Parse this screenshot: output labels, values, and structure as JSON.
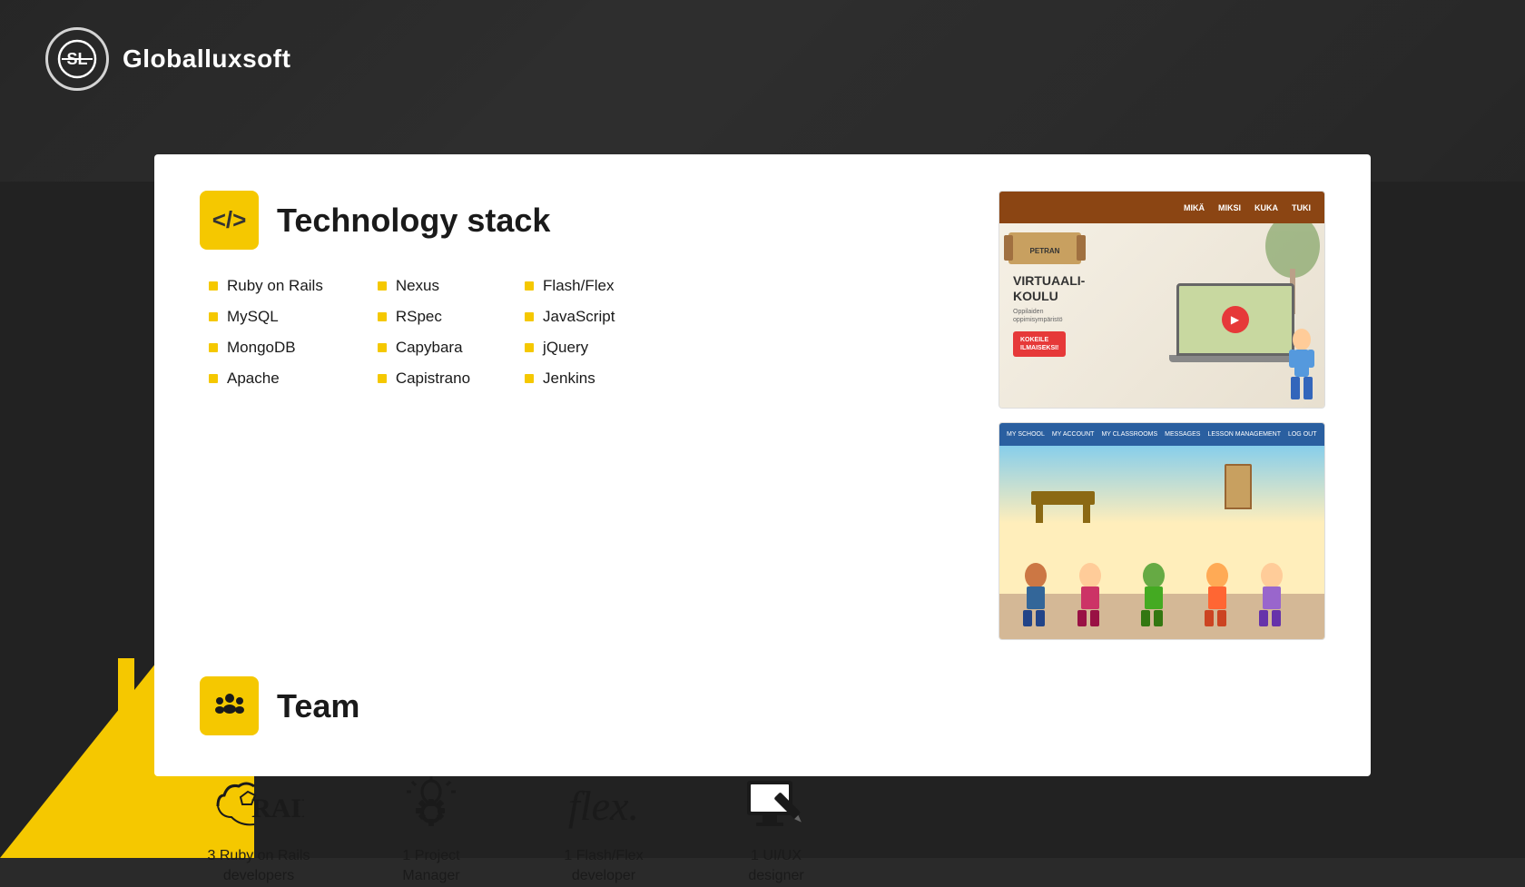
{
  "company": {
    "name": "Globalluxsoft",
    "logo_alt": "GL logo"
  },
  "tech_section": {
    "title": "Technology stack",
    "icon_label": "</>",
    "columns": [
      {
        "items": [
          "Ruby on Rails",
          "MySQL",
          "MongoDB",
          "Apache"
        ]
      },
      {
        "items": [
          "Nexus",
          "RSpec",
          "Capybara",
          "Capistrano"
        ]
      },
      {
        "items": [
          "Flash/Flex",
          "JavaScript",
          "jQuery",
          "Jenkins"
        ]
      }
    ]
  },
  "team_section": {
    "title": "Team",
    "members": [
      {
        "count": "3",
        "role": "Ruby on Rails developers",
        "icon_type": "rails"
      },
      {
        "count": "1",
        "role": "Project Manager",
        "icon_type": "gear"
      },
      {
        "count": "1",
        "role": "Flash/Flex developer",
        "icon_type": "flex"
      },
      {
        "count": "1",
        "role": "UI/UX designer",
        "icon_type": "monitor"
      }
    ]
  },
  "screenshot1": {
    "nav_items": [
      "MIKÄ",
      "MIKSI",
      "KUKA",
      "TUKI"
    ],
    "title": "VIRTUAALIKOULU",
    "subtitle": "Oppilaiden oppimisympäristö",
    "cta": "KOKEILE ILMAISEKSI!"
  },
  "screenshot2": {
    "nav_items": [
      "MY SCHOOL",
      "MY ACCOUNT",
      "MY CLASSROOMS",
      "MESSAGES",
      "LESSON MANAGEMENT",
      "LOG OUT"
    ]
  }
}
